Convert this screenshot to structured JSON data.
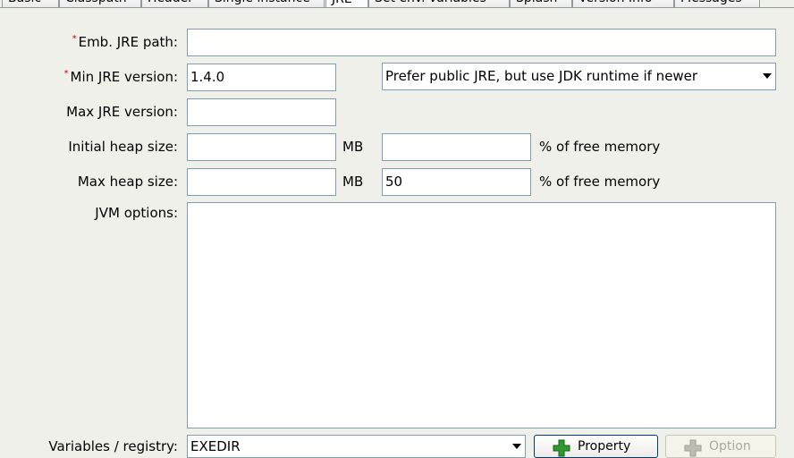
{
  "tabs": [
    {
      "label": "Basic",
      "active": false
    },
    {
      "label": "Classpath",
      "active": false
    },
    {
      "label": "Header",
      "active": false
    },
    {
      "label": "Single instance",
      "active": false
    },
    {
      "label": "JRE",
      "active": true
    },
    {
      "label": "Set env. variables",
      "active": false
    },
    {
      "label": "Splash",
      "active": false
    },
    {
      "label": "Version Info",
      "active": false
    },
    {
      "label": "Messages",
      "active": false
    }
  ],
  "form": {
    "required_marker": "*",
    "emb_jre_path": {
      "label": "Emb. JRE path:",
      "value": ""
    },
    "min_jre_version": {
      "label": "Min JRE version:",
      "value": "1.4.0"
    },
    "jdk_preference": {
      "selected": "Prefer public JRE, but use JDK runtime if newer"
    },
    "max_jre_version": {
      "label": "Max JRE version:",
      "value": ""
    },
    "initial_heap": {
      "label": "Initial heap size:",
      "value": "",
      "unit": "MB",
      "percent_value": "",
      "percent_label": "% of free memory"
    },
    "max_heap": {
      "label": "Max heap size:",
      "value": "",
      "unit": "MB",
      "percent_value": "50",
      "percent_label": "% of free memory"
    },
    "jvm_options": {
      "label": "JVM options:",
      "value": ""
    },
    "variables": {
      "label": "Variables / registry:",
      "selected": "EXEDIR"
    },
    "property_button": "Property",
    "option_button": "Option"
  },
  "colors": {
    "background": "#f0f0ea",
    "field_border": "#7f9db9",
    "required": "#d40000",
    "active_tab_accent": "#ffc83c",
    "add_icon": "#2e9a2e"
  }
}
